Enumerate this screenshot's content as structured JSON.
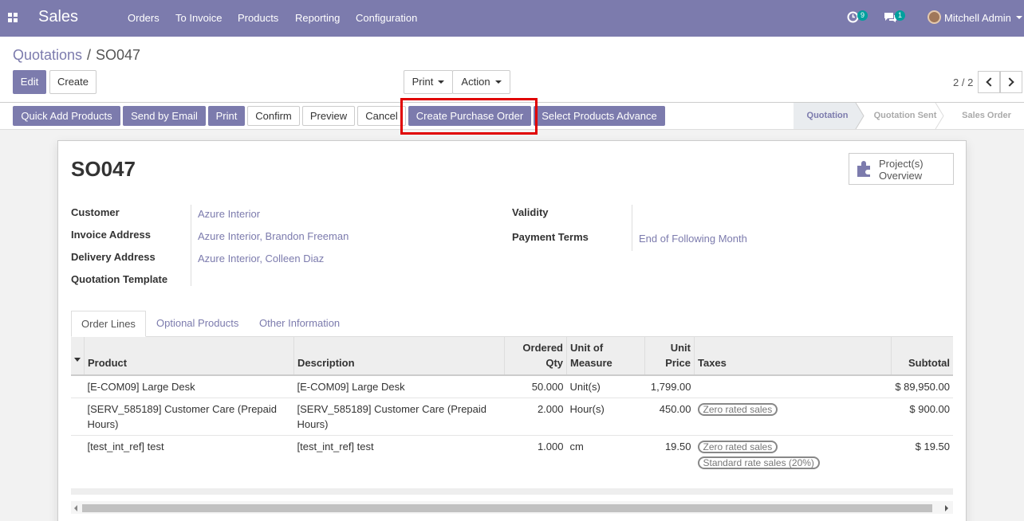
{
  "app": {
    "title": "Sales"
  },
  "menu": [
    "Orders",
    "To Invoice",
    "Products",
    "Reporting",
    "Configuration"
  ],
  "systray": {
    "activity_count": "9",
    "message_count": "1",
    "user": "Mitchell Admin"
  },
  "breadcrumb": {
    "parent": "Quotations",
    "separator": "/",
    "current": "SO047"
  },
  "toolbar": {
    "edit": "Edit",
    "create": "Create",
    "print": "Print",
    "action": "Action"
  },
  "pager": {
    "value": "2 / 2"
  },
  "statusbar": {
    "buttons": [
      "Quick Add Products",
      "Send by Email",
      "Print",
      "Confirm",
      "Preview",
      "Cancel",
      "Create Purchase Order",
      "Select Products Advance"
    ],
    "stages": [
      "Quotation",
      "Quotation Sent",
      "Sales Order"
    ]
  },
  "form": {
    "name": "SO047",
    "smart_button": {
      "line1": "Project(s)",
      "line2": "Overview"
    },
    "fields": {
      "customer_label": "Customer",
      "customer": "Azure Interior",
      "invoice_label": "Invoice Address",
      "invoice": "Azure Interior, Brandon Freeman",
      "delivery_label": "Delivery Address",
      "delivery": "Azure Interior, Colleen Diaz",
      "template_label": "Quotation Template",
      "validity_label": "Validity",
      "terms_label": "Payment Terms",
      "terms": "End of Following Month"
    },
    "tabs": [
      "Order Lines",
      "Optional Products",
      "Other Information"
    ]
  },
  "lines": {
    "headers": {
      "product": "Product",
      "description": "Description",
      "qty1": "Ordered",
      "qty2": "Qty",
      "uom1": "Unit of",
      "uom2": "Measure",
      "price1": "Unit",
      "price2": "Price",
      "taxes": "Taxes",
      "subtotal": "Subtotal"
    },
    "rows": [
      {
        "product": "[E-COM09] Large Desk",
        "description": "[E-COM09] Large Desk",
        "qty": "50.000",
        "uom": "Unit(s)",
        "price": "1,799.00",
        "tax1": "",
        "tax2": "",
        "subtotal": "$ 89,950.00"
      },
      {
        "product": "[SERV_585189] Customer Care (Prepaid Hours)",
        "description": "[SERV_585189] Customer Care (Prepaid Hours)",
        "qty": "2.000",
        "uom": "Hour(s)",
        "price": "450.00",
        "tax1": "Zero rated sales",
        "tax2": "",
        "subtotal": "$ 900.00"
      },
      {
        "product": "[test_int_ref] test",
        "description": "[test_int_ref] test",
        "qty": "1.000",
        "uom": "cm",
        "price": "19.50",
        "tax1": "Zero rated sales",
        "tax2": "Standard rate sales (20%)",
        "subtotal": "$ 19.50"
      }
    ]
  },
  "colors": {
    "brand": "#7c7bad",
    "highlight": "#e00000",
    "badge": "#00a09d"
  }
}
